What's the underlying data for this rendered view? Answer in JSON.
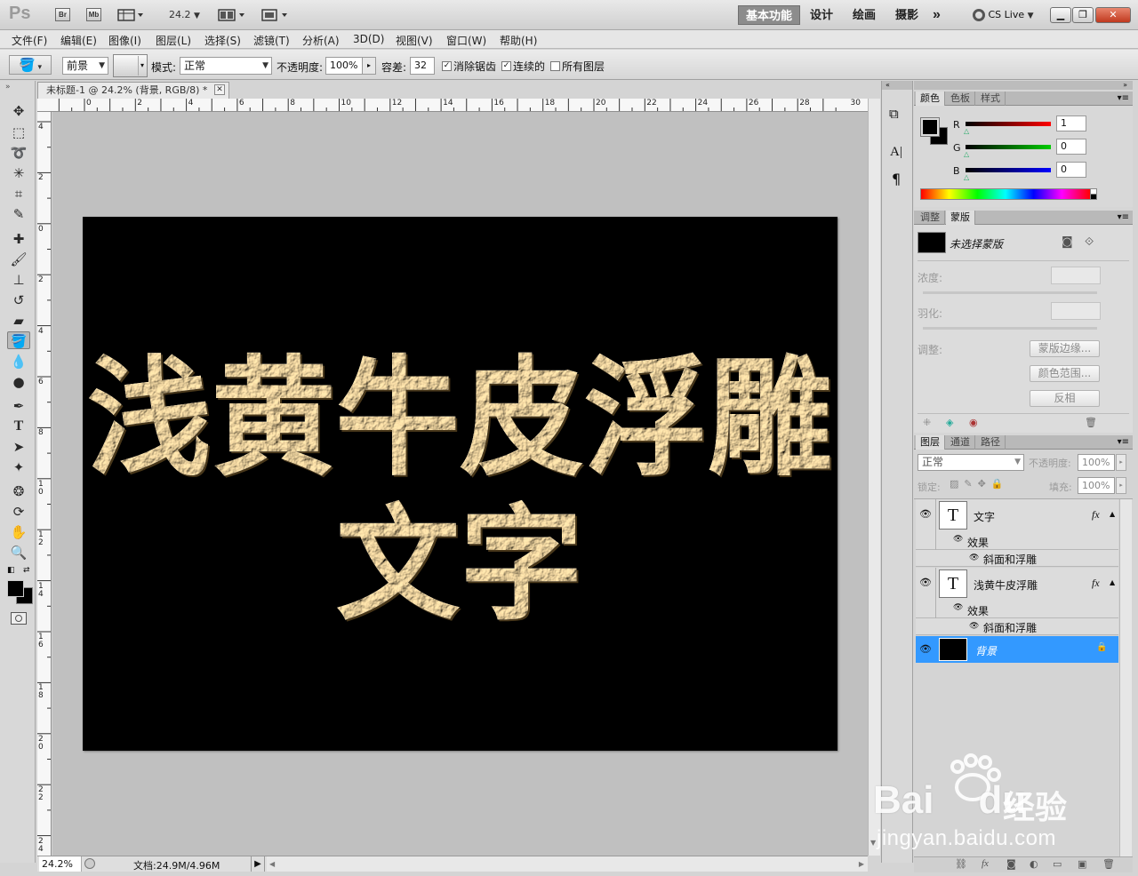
{
  "app": {
    "logo": "Ps",
    "quick_buttons": [
      "Br",
      "Mb"
    ],
    "zoom_box": "24.2",
    "workspaces": [
      "基本功能",
      "设计",
      "绘画",
      "摄影"
    ],
    "cs_live": "CS Live",
    "more": "»"
  },
  "menu": [
    "文件(F)",
    "编辑(E)",
    "图像(I)",
    "图层(L)",
    "选择(S)",
    "滤镜(T)",
    "分析(A)",
    "3D(D)",
    "视图(V)",
    "窗口(W)",
    "帮助(H)"
  ],
  "options": {
    "fill_source": "前景",
    "mode_label": "模式:",
    "mode_value": "正常",
    "opacity_label": "不透明度:",
    "opacity_value": "100%",
    "tolerance_label": "容差:",
    "tolerance_value": "32",
    "antialias_label": "消除锯齿",
    "contiguous_label": "连续的",
    "all_layers_label": "所有图层",
    "antialias_checked": true,
    "contiguous_checked": true,
    "all_layers_checked": false
  },
  "document": {
    "tab_title": "未标题-1 @ 24.2% (背景, RGB/8) *",
    "close": "✕",
    "ruler_h": [
      "0",
      "2",
      "4",
      "6",
      "8",
      "10",
      "12",
      "14",
      "16",
      "18",
      "20",
      "22",
      "24",
      "26",
      "28",
      "30"
    ],
    "ruler_v": [
      "4",
      "2",
      "0",
      "2",
      "4",
      "6",
      "8",
      "1 0",
      "1 2",
      "1 4",
      "1 6",
      "1 8",
      "2 0",
      "2 2",
      "2 4"
    ],
    "canvas_text_line1": "浅黄牛皮浮雕",
    "canvas_text_line2": "文字",
    "canvas_bg": "#000000",
    "text_color": "#ecd29e"
  },
  "status": {
    "zoom": "24.2%",
    "doc_info": "文档:24.9M/4.96M"
  },
  "color_panel": {
    "tabs": [
      "颜色",
      "色板",
      "样式"
    ],
    "channels": [
      {
        "label": "R",
        "value": "1"
      },
      {
        "label": "G",
        "value": "0"
      },
      {
        "label": "B",
        "value": "0"
      }
    ]
  },
  "masks_panel": {
    "tabs": [
      "调整",
      "蒙版"
    ],
    "title": "未选择蒙版",
    "density_label": "浓度:",
    "feather_label": "羽化:",
    "adjust_label": "调整:",
    "mask_edge_btn": "蒙版边缘...",
    "color_range_btn": "颜色范围...",
    "invert_btn": "反相"
  },
  "layers_panel": {
    "tabs": [
      "图层",
      "通道",
      "路径"
    ],
    "blend_mode": "正常",
    "opacity_label": "不透明度:",
    "opacity_value": "100%",
    "lock_label": "锁定:",
    "fill_label": "填充:",
    "fill_value": "100%",
    "layers": [
      {
        "name": "文字",
        "thumb": "T",
        "fx": "fx",
        "effects_label": "效果",
        "effect": "斜面和浮雕"
      },
      {
        "name": "浅黄牛皮浮雕",
        "thumb": "T",
        "fx": "fx",
        "effects_label": "效果",
        "effect": "斜面和浮雕"
      },
      {
        "name": "背景",
        "selected": true
      }
    ]
  },
  "watermark": {
    "brand_a": "Bai",
    "brand_b": "du",
    "brand_cn": "经验",
    "url": "jingyan.baidu.com"
  }
}
